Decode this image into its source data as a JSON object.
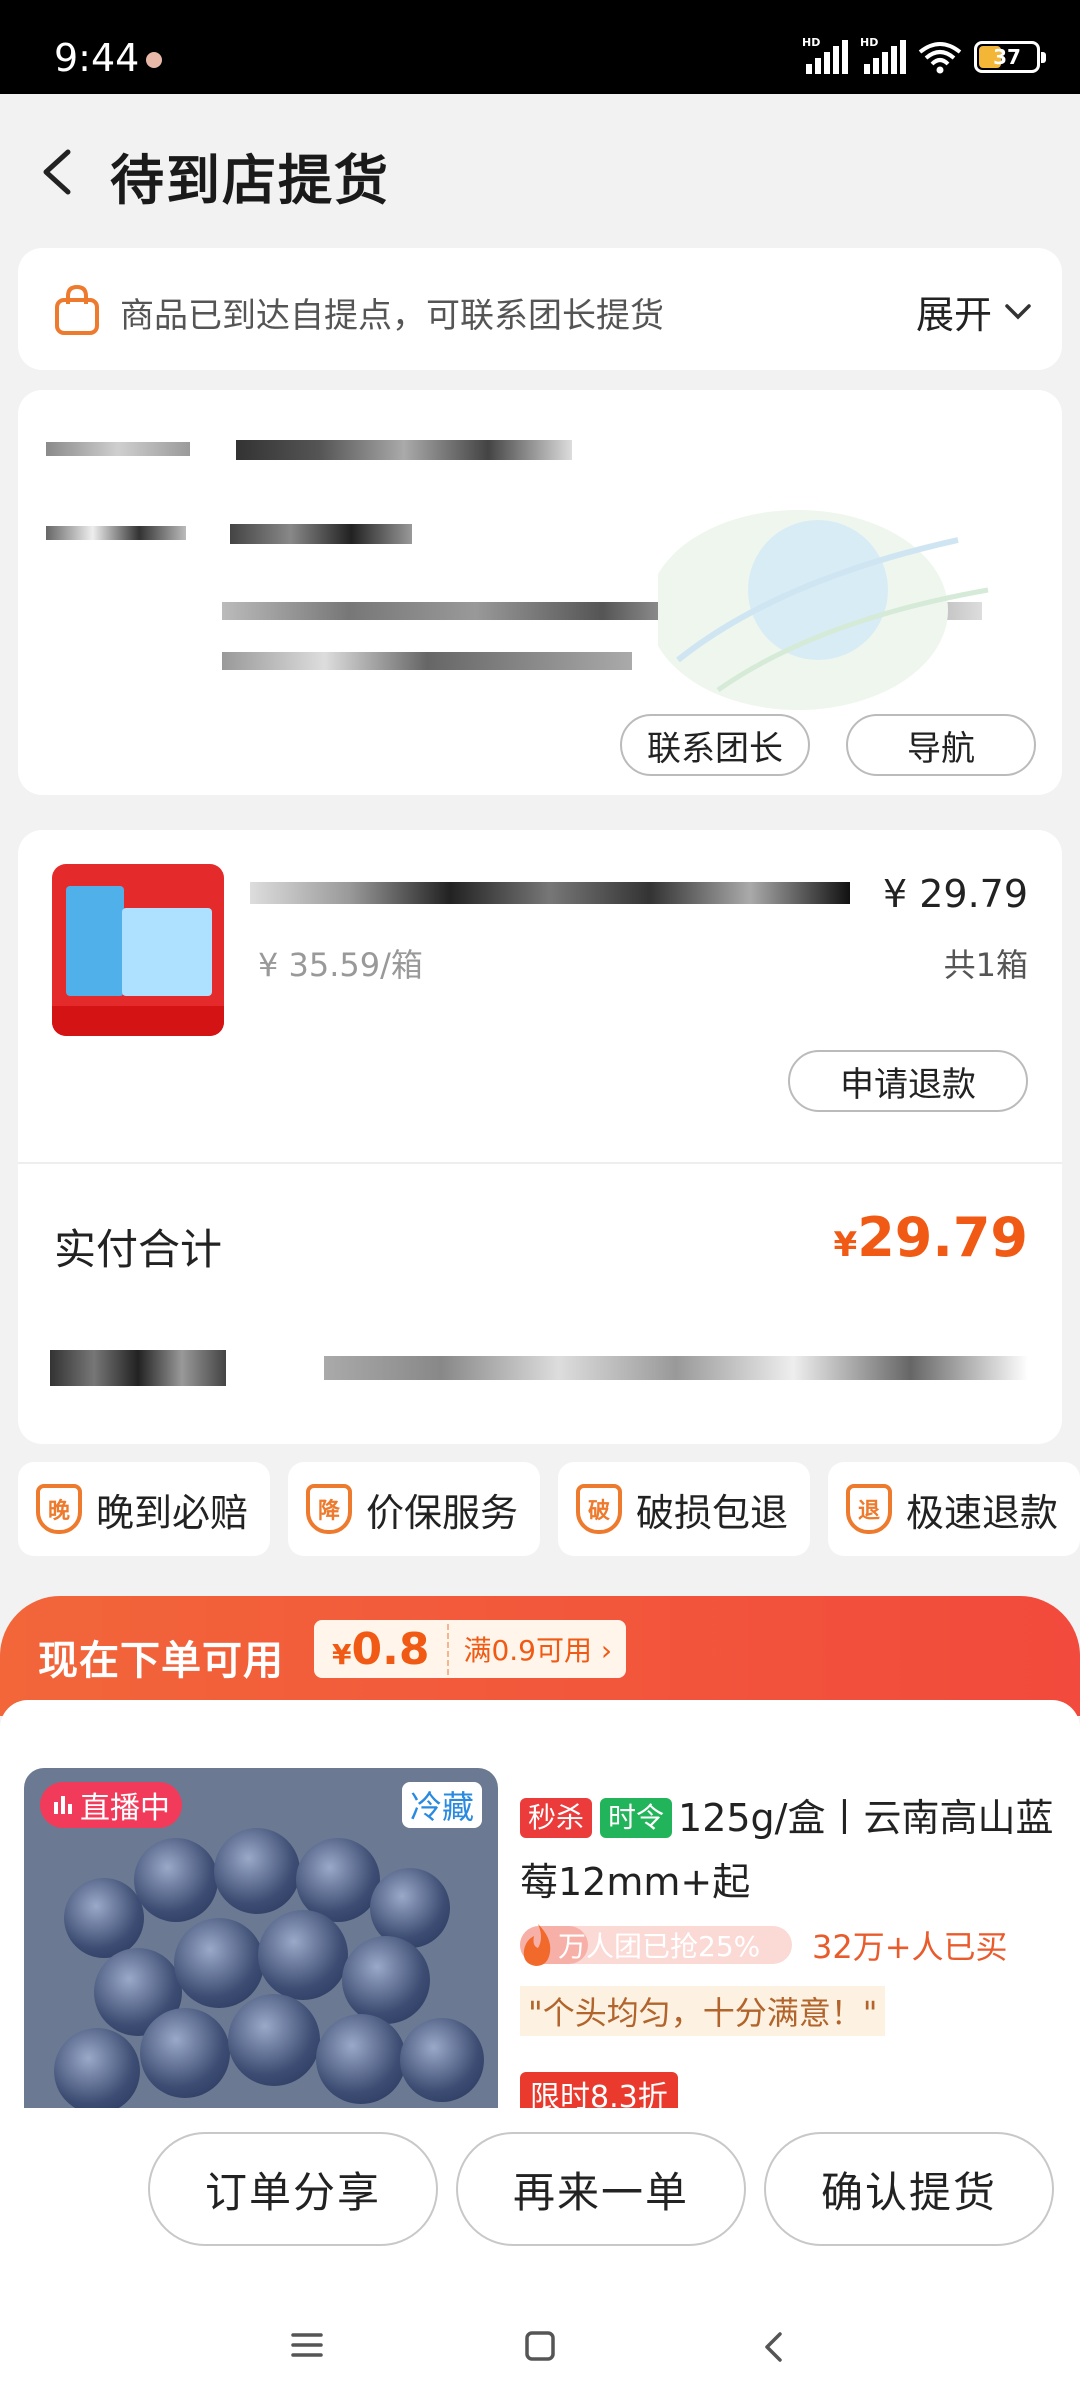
{
  "status": {
    "time": "9:44",
    "battery": "37",
    "signal_label": "HD"
  },
  "nav": {
    "title": "待到店提货"
  },
  "notice": {
    "text": "商品已到达自提点，可联系团长提货",
    "expand_label": "展开"
  },
  "pickup": {
    "contact_label": "联系团长",
    "navigate_label": "导航"
  },
  "order": {
    "price": "¥ 29.79",
    "unit_price": "¥ 35.59/箱",
    "quantity": "共1箱",
    "refund_label": "申请退款",
    "total_label": "实付合计",
    "total_currency": "¥",
    "total_value": "29.79"
  },
  "services": [
    {
      "icon_text": "晚",
      "label": "晚到必赔"
    },
    {
      "icon_text": "降",
      "label": "价保服务"
    },
    {
      "icon_text": "破",
      "label": "破损包退"
    },
    {
      "icon_text": "退",
      "label": "极速退款"
    }
  ],
  "promo": {
    "title": "现在下单可用",
    "currency": "¥",
    "amount": "0.8",
    "condition": "满0.9可用"
  },
  "recommend": {
    "live_tag": "直播中",
    "cold_tag": "冷藏",
    "tag_flash": "秒杀",
    "tag_season": "时令",
    "title": "125g/盒丨云南高山蓝莓12mm+起",
    "hot_prefix": "万",
    "hot_text": "人团已抢25%",
    "hot_progress": 0.25,
    "bought": "32万+人已买",
    "review": "\"个头均匀，十分满意！\"",
    "limit_tag": "限时8.3折"
  },
  "actions": {
    "share_label": "订单分享",
    "reorder_label": "再来一单",
    "confirm_label": "确认提货"
  },
  "colors": {
    "accent": "#f05a14",
    "promo_bg": "#f2663a",
    "live_tag": "#f23b5a",
    "season_tag": "#21b45a"
  },
  "icons": [
    "back-arrow-icon",
    "shopping-bag-icon",
    "chevron-down-icon",
    "shield-icon",
    "flame-icon",
    "menu-icon",
    "home-icon",
    "back-icon"
  ]
}
